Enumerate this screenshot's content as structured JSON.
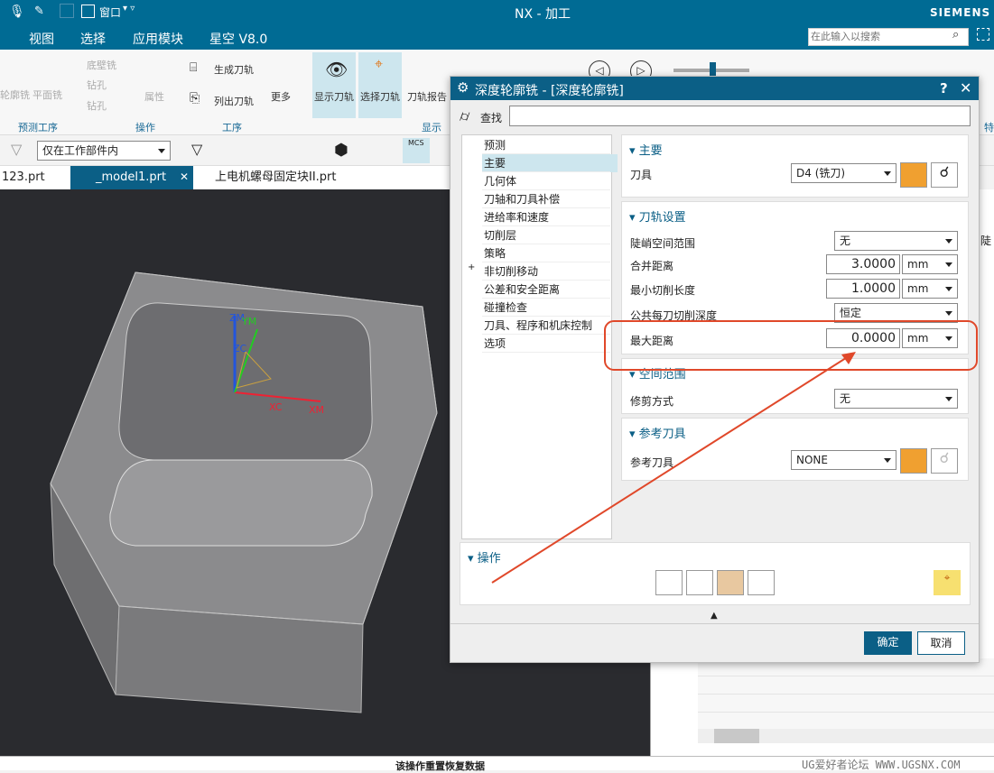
{
  "app": {
    "title": "NX - 加工",
    "brand": "SIEMENS",
    "window_menu": "窗口",
    "search_placeholder": "在此输入以搜索"
  },
  "menu": [
    "视图",
    "选择",
    "应用模块",
    "星空 V8.0"
  ],
  "ribbon": {
    "items": [
      "轮廓铣",
      "平面铣",
      "底壁铣",
      "钻孔",
      "钻孔",
      "属性",
      "生成刀轨",
      "列出刀轨",
      "更多",
      "显示刀轨",
      "选择刀轨",
      "刀轨报告"
    ],
    "groups": [
      "预测工序",
      "操作",
      "工序",
      "显示"
    ],
    "right_label": "特"
  },
  "toolbar": {
    "filter_value": "仅在工作部件内",
    "mcs_label": "MCS"
  },
  "tabs": [
    {
      "label": "123.prt"
    },
    {
      "label": "_model1.prt",
      "active": true
    },
    {
      "label": "上电机螺母固定块II.prt"
    }
  ],
  "viewport": {
    "axes": [
      "ZM",
      "YM",
      "ZC",
      "XC",
      "XM"
    ]
  },
  "dialog": {
    "title": "深度轮廓铣 - [深度轮廓铣]",
    "help": "?",
    "close": "✕",
    "find_label": "查找",
    "find_value": "",
    "tree": [
      "预测",
      "主要",
      "几何体",
      "刀轴和刀具补偿",
      "进给率和速度",
      "切削层",
      "策略",
      "非切削移动",
      "公差和安全距离",
      "碰撞检查",
      "刀具、程序和机床控制",
      "选项"
    ],
    "tree_selected": 1,
    "main": {
      "header": "主要",
      "tool_label": "刀具",
      "tool_value": "D4 (铣刀)"
    },
    "path": {
      "header": "刀轨设置",
      "steep_label": "陡峭空间范围",
      "steep_value": "无",
      "merge_label": "合并距离",
      "merge_value": "3.0000",
      "merge_unit": "mm",
      "minlen_label": "最小切削长度",
      "minlen_value": "1.0000",
      "minlen_unit": "mm",
      "depth_label": "公共每刀切削深度",
      "depth_value": "恒定",
      "maxdist_label": "最大距离",
      "maxdist_value": "0.0000",
      "maxdist_unit": "mm"
    },
    "space": {
      "header": "空间范围",
      "trim_label": "修剪方式",
      "trim_value": "无"
    },
    "ref": {
      "header": "参考刀具",
      "ref_label": "参考刀具",
      "ref_value": "NONE"
    },
    "ops": {
      "header": "操作"
    },
    "ok": "确定",
    "cancel": "取消"
  },
  "right_panel": {
    "label": "陡"
  },
  "status": "该操作重置恢复数据",
  "watermark": "UG爱好者论坛 WWW.UGSNX.COM",
  "colors": {
    "title": "#006b94",
    "dialog_title": "#0b5f86",
    "annotation": "#e0482a"
  }
}
